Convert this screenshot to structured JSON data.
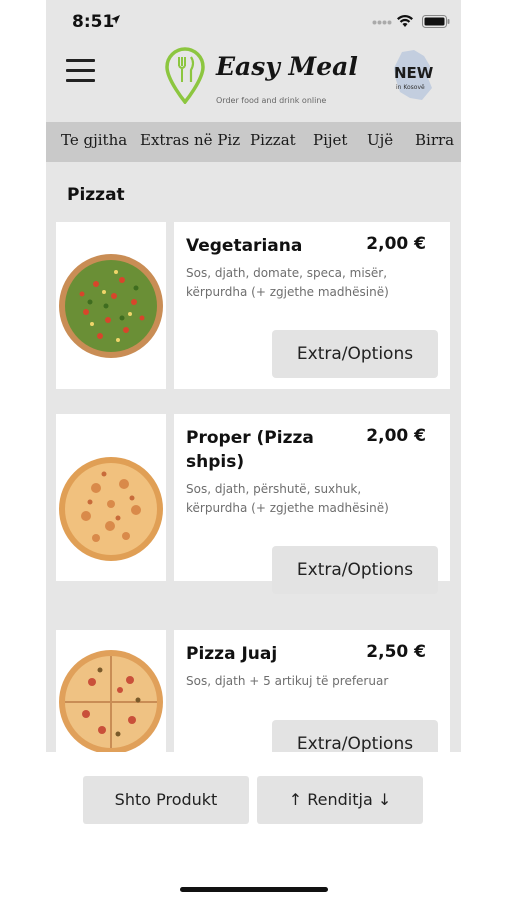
{
  "status": {
    "time": "8:51"
  },
  "header": {
    "brand_name": "Easy Meal",
    "tagline": "Order food and drink online",
    "badge_new": "NEW",
    "badge_sub": "in Kosovë"
  },
  "tabs": [
    {
      "label": "Te gjitha"
    },
    {
      "label": "Extras në Piz"
    },
    {
      "label": "Pizzat"
    },
    {
      "label": "Pijet"
    },
    {
      "label": "Ujë"
    },
    {
      "label": "Birra"
    }
  ],
  "section_title": "Pizzat",
  "products": [
    {
      "name": "Vegetariana",
      "price": "2,00 €",
      "description": "Sos, djath, domate, speca, misër, kërpurdha (+ zgjethe madhësinë)",
      "options_label": "Extra/Options",
      "image_icon": "vegetarian-pizza-image"
    },
    {
      "name": "Proper (Pizza shpis)",
      "price": "2,00 €",
      "description": "Sos, djath, përshutë, suxhuk, kërpurdha (+ zgjethe madhësinë)",
      "options_label": "Extra/Options",
      "image_icon": "house-pizza-image"
    },
    {
      "name": "Pizza Juaj",
      "price": "2,50 €",
      "description": "Sos, djath + 5 artikuj të preferuar",
      "options_label": "Extra/Options",
      "image_icon": "custom-pizza-image"
    }
  ],
  "bottom": {
    "add_product": "Shto Produkt",
    "sort": "↑ Renditja ↓"
  },
  "colors": {
    "screen_bg": "#e6e6e6",
    "tabs_bg": "#c9c9c9",
    "button_bg": "#e3e3e3",
    "logo_green": "#8cc63f"
  }
}
